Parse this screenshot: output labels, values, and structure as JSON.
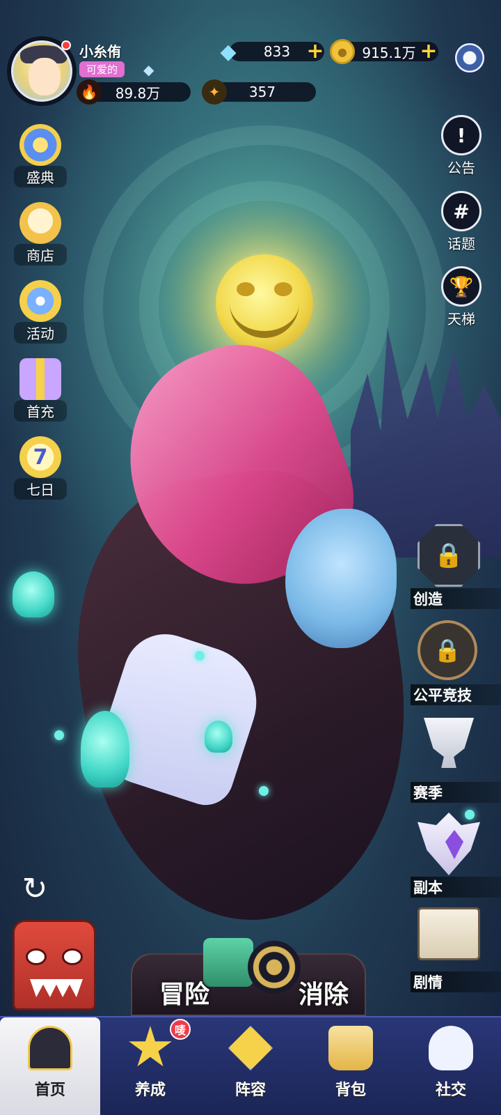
{
  "player": {
    "name": "小糸侑",
    "title_badge": "可爱的",
    "power": "89.8万",
    "stars": "357"
  },
  "currency": {
    "diamonds": "833",
    "coins": "915.1万"
  },
  "left_menu": [
    {
      "label": "盛典",
      "icon": "festival-star-icon"
    },
    {
      "label": "商店",
      "icon": "lucky-cat-icon"
    },
    {
      "label": "活动",
      "icon": "flower-clock-icon"
    },
    {
      "label": "首充",
      "icon": "gift-box-icon"
    },
    {
      "label": "七日",
      "icon": "seven-day-icon",
      "number": "7"
    }
  ],
  "right_menu": [
    {
      "label": "公告",
      "icon": "announcement-icon"
    },
    {
      "label": "话题",
      "icon": "hashtag-icon"
    },
    {
      "label": "天梯",
      "icon": "trophy-icon"
    }
  ],
  "modes": [
    {
      "label": "创造",
      "icon": "lock-icon"
    },
    {
      "label": "公平竞技",
      "icon": "lock-icon"
    },
    {
      "label": "赛季",
      "icon": "trophy-cup-icon"
    },
    {
      "label": "副本",
      "icon": "crest-icon"
    },
    {
      "label": "剧情",
      "icon": "storybook-icon"
    }
  ],
  "play": {
    "adventure_label": "冒险",
    "eliminate_label": "消除"
  },
  "tabs": [
    {
      "label": "首页",
      "icon": "home-icon",
      "active": true
    },
    {
      "label": "养成",
      "icon": "star-icon",
      "badge": "唛"
    },
    {
      "label": "阵容",
      "icon": "formation-icon"
    },
    {
      "label": "背包",
      "icon": "bag-icon"
    },
    {
      "label": "社交",
      "icon": "social-icon"
    }
  ],
  "colors": {
    "tabbar": "#2a3778",
    "badge_pink": "#e06fd0",
    "gold_plus": "#ffd43a",
    "notif_red": "#ff3b3b"
  }
}
